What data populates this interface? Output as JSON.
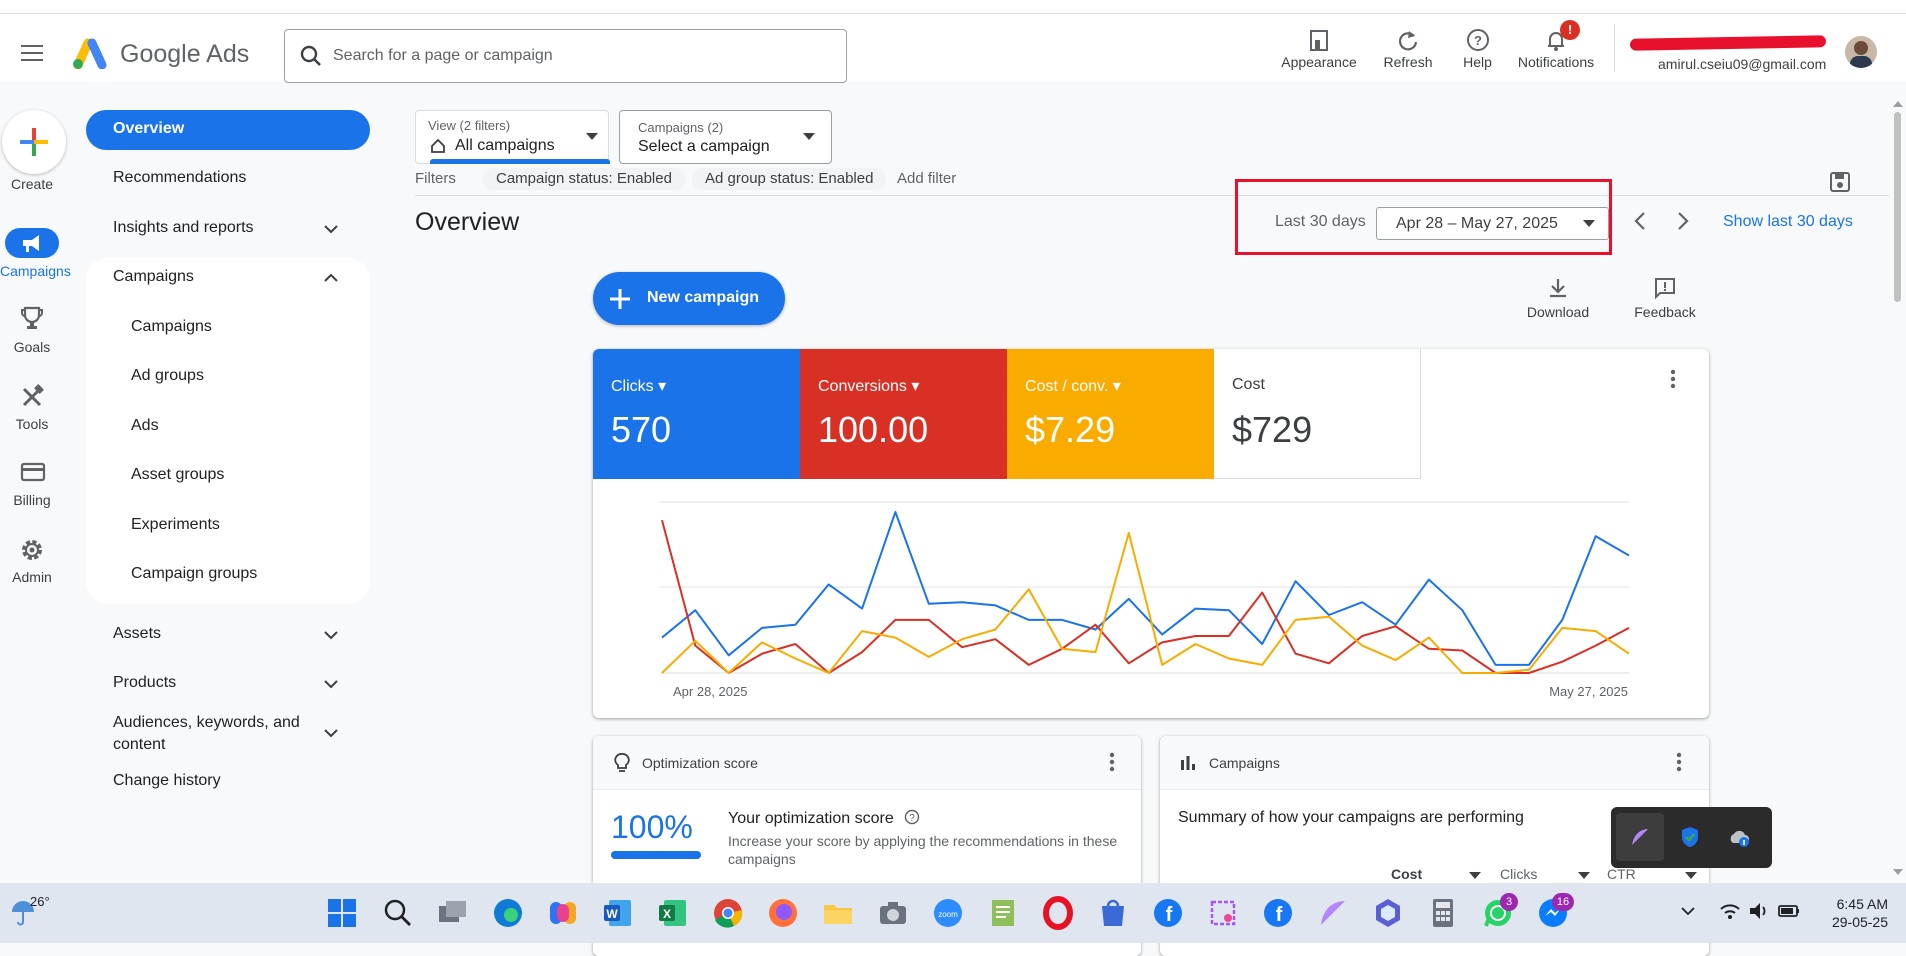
{
  "app": {
    "name": "Google Ads"
  },
  "search": {
    "placeholder": "Search for a page or campaign"
  },
  "top_actions": [
    {
      "label": "Appearance",
      "icon": "appearance-icon"
    },
    {
      "label": "Refresh",
      "icon": "refresh-icon"
    },
    {
      "label": "Help",
      "icon": "help-icon"
    },
    {
      "label": "Notifications",
      "icon": "bell-icon",
      "badge": "!"
    }
  ],
  "account": {
    "email": "amirul.cseiu09@gmail.com"
  },
  "rail": [
    {
      "label": "Create"
    },
    {
      "label": "Campaigns"
    },
    {
      "label": "Goals"
    },
    {
      "label": "Tools"
    },
    {
      "label": "Billing"
    },
    {
      "label": "Admin"
    }
  ],
  "nav": {
    "overview": "Overview",
    "recommendations": "Recommendations",
    "insights": "Insights and reports",
    "campaigns_group": "Campaigns",
    "sub": [
      "Campaigns",
      "Ad groups",
      "Ads",
      "Asset groups",
      "Experiments",
      "Campaign groups"
    ],
    "assets": "Assets",
    "products": "Products",
    "audiences_line1": "Audiences, keywords, and",
    "audiences_line2": "content",
    "change_history": "Change history"
  },
  "selectors": {
    "view_label": "View (2 filters)",
    "view_value": "All campaigns",
    "campaigns_label": "Campaigns (2)",
    "campaigns_value": "Select a campaign"
  },
  "filters": {
    "label": "Filters",
    "chips": [
      "Campaign status: Enabled",
      "Ad group status: Enabled"
    ],
    "add": "Add filter"
  },
  "page": {
    "title": "Overview"
  },
  "date": {
    "preset": "Last 30 days",
    "range": "Apr 28 – May 27, 2025",
    "show": "Show last 30 days"
  },
  "actions": {
    "new_campaign": "New campaign",
    "download": "Download",
    "feedback": "Feedback"
  },
  "metrics": [
    {
      "label": "Clicks",
      "value": "570",
      "color": "#1a73e8"
    },
    {
      "label": "Conversions",
      "value": "100.00",
      "color": "#d93025"
    },
    {
      "label": "Cost / conv.",
      "value": "$7.29",
      "color": "#f9ab00"
    },
    {
      "label": "Cost",
      "value": "$729",
      "color": "#ffffff"
    }
  ],
  "chart_data": {
    "type": "line",
    "x_start": "Apr 28, 2025",
    "x_end": "May 27, 2025",
    "series": [
      {
        "name": "Clicks",
        "color": "#1a73e8",
        "values": [
          0.22,
          0.39,
          0.11,
          0.28,
          0.3,
          0.55,
          0.4,
          1.0,
          0.43,
          0.44,
          0.42,
          0.33,
          0.33,
          0.27,
          0.46,
          0.24,
          0.4,
          0.39,
          0.18,
          0.57,
          0.36,
          0.44,
          0.3,
          0.58,
          0.39,
          0.05,
          0.05,
          0.33,
          0.85,
          0.73
        ]
      },
      {
        "name": "Conversions",
        "color": "#d93025",
        "values": [
          0.95,
          0.17,
          0.0,
          0.12,
          0.18,
          0.0,
          0.13,
          0.33,
          0.33,
          0.16,
          0.21,
          0.05,
          0.15,
          0.3,
          0.06,
          0.19,
          0.23,
          0.23,
          0.5,
          0.12,
          0.06,
          0.23,
          0.29,
          0.15,
          0.14,
          0.0,
          0.0,
          0.07,
          0.17,
          0.28
        ]
      },
      {
        "name": "Cost / conv.",
        "color": "#f9ab00",
        "values": [
          0.0,
          0.2,
          0.0,
          0.19,
          0.09,
          0.0,
          0.26,
          0.22,
          0.1,
          0.21,
          0.27,
          0.52,
          0.15,
          0.13,
          0.87,
          0.05,
          0.18,
          0.09,
          0.05,
          0.33,
          0.35,
          0.17,
          0.08,
          0.22,
          0.0,
          0.0,
          0.02,
          0.28,
          0.26,
          0.12
        ]
      }
    ]
  },
  "opt_card": {
    "header": "Optimization score",
    "score": "100%",
    "title": "Your optimization score",
    "desc_line1": "Increase your score by applying the recommendations in these",
    "desc_line2": "campaigns"
  },
  "camp_card": {
    "header": "Campaigns",
    "summary": "Summary of how your campaigns are performing",
    "cols": [
      "Cost",
      "Clicks",
      "CTR"
    ]
  },
  "taskbar": {
    "weather": "26°",
    "time": "6:45 AM",
    "date": "29-05-25",
    "whatsapp_badge": "3",
    "messenger_badge": "16"
  }
}
